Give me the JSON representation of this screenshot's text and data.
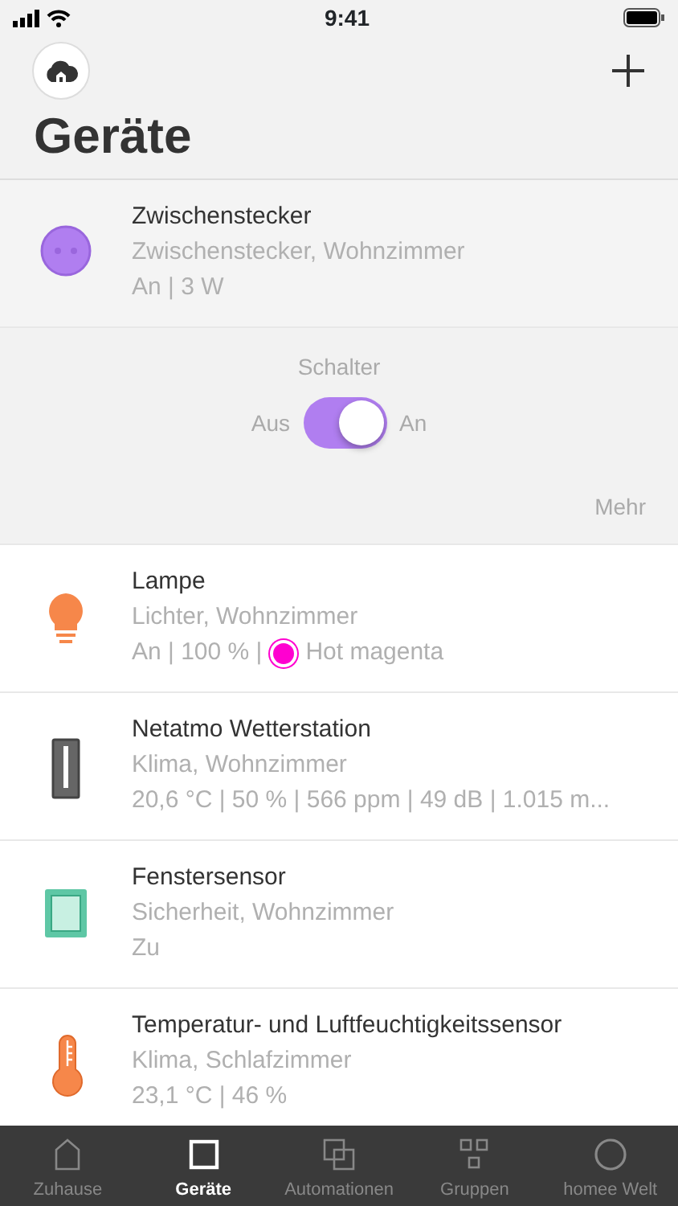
{
  "status_bar": {
    "time": "9:41"
  },
  "header": {
    "title": "Geräte"
  },
  "devices": [
    {
      "kind": "plug",
      "name": "Zwischenstecker",
      "subtitle": "Zwischenstecker, Wohnzimmer",
      "status": "An | 3 W",
      "control": {
        "label": "Schalter",
        "off_label": "Aus",
        "on_label": "An",
        "on": true,
        "more": "Mehr"
      }
    },
    {
      "kind": "bulb",
      "name": "Lampe",
      "subtitle": "Lichter, Wohnzimmer",
      "status": "An | 100 % |",
      "color": "#ff00d0",
      "color_name": "Hot magenta"
    },
    {
      "kind": "station",
      "name": "Netatmo Wetterstation",
      "subtitle": "Klima, Wohnzimmer",
      "status": "20,6 °C | 50 % | 566 ppm | 49 dB | 1.015 m..."
    },
    {
      "kind": "window",
      "name": "Fenstersensor",
      "subtitle": "Sicherheit, Wohnzimmer",
      "status": "Zu"
    },
    {
      "kind": "thermo",
      "name": "Temperatur- und Luftfeuchtigkeitssensor",
      "subtitle": "Klima, Schlafzimmer",
      "status": "23,1 °C | 46 %"
    }
  ],
  "tab_bar": [
    {
      "kind": "home",
      "label": "Zuhause",
      "selected": false
    },
    {
      "kind": "square",
      "label": "Geräte",
      "selected": true
    },
    {
      "kind": "squares",
      "label": "Automationen",
      "selected": false
    },
    {
      "kind": "grid",
      "label": "Gruppen",
      "selected": false
    },
    {
      "kind": "circle",
      "label": "homee Welt",
      "selected": false
    }
  ]
}
